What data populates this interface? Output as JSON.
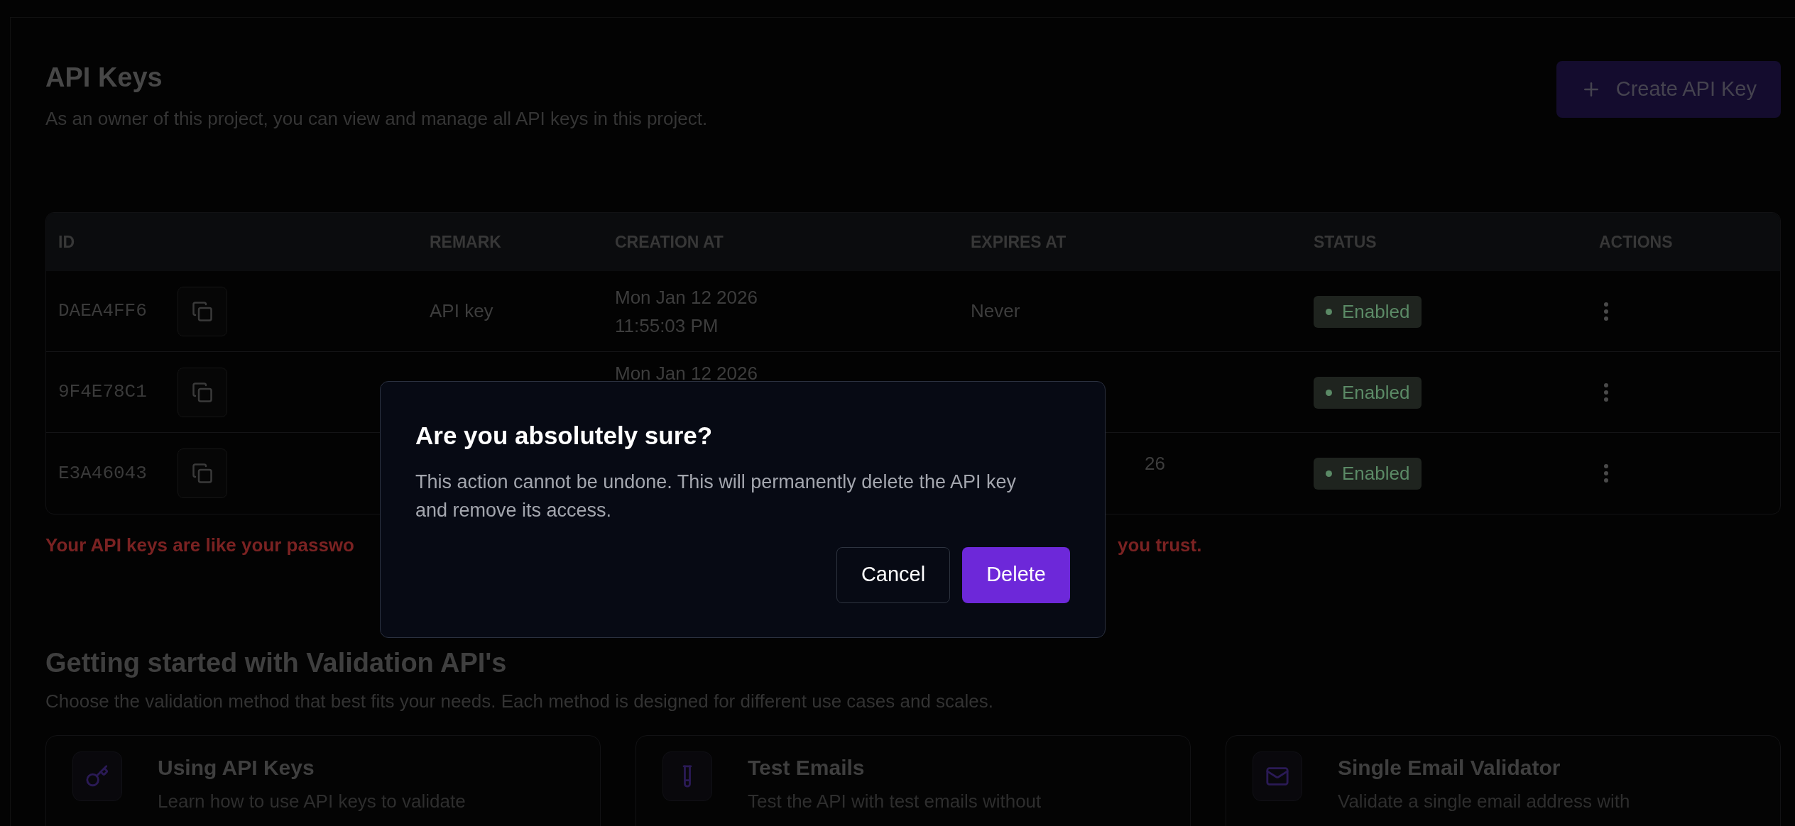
{
  "page": {
    "title": "API Keys",
    "subtitle": "As an owner of this project, you can view and manage all API keys in this project."
  },
  "create_button": {
    "label": "Create API Key"
  },
  "table": {
    "columns": [
      "ID",
      "REMARK",
      "CREATION AT",
      "EXPIRES AT",
      "STATUS",
      "ACTIONS"
    ],
    "rows": [
      {
        "id": "DAEA4FF6",
        "remark": "API key",
        "creation_at": [
          "Mon Jan 12 2026",
          "11:55:03 PM"
        ],
        "expires_at": "Never",
        "status": "Enabled"
      },
      {
        "id": "9F4E78C1",
        "creation_at": [
          "Mon Jan 12 2026"
        ],
        "status": "Enabled"
      },
      {
        "id": "E3A46043",
        "expires_at": "26",
        "status": "Enabled"
      }
    ]
  },
  "warning": [
    "Your API keys are like your passwo",
    "you trust."
  ],
  "getting_started": {
    "title": "Getting started with Validation API's",
    "subtitle": "Choose the validation method that best fits your needs. Each method is designed for different use cases and scales.",
    "cards": [
      {
        "kind": "key",
        "title": "Using API Keys",
        "description": "Learn how to use API keys to validate"
      },
      {
        "kind": "test",
        "title": "Test Emails",
        "description": "Test the API with test emails without"
      },
      {
        "kind": "mail",
        "title": "Single Email Validator",
        "description": "Validate a single email address with"
      }
    ]
  },
  "dialog": {
    "title": "Are you absolutely sure?",
    "message": "This action cannot be undone. This will permanently delete the API key and remove its access.",
    "buttons": [
      {
        "label": "Cancel",
        "kind": "secondary"
      },
      {
        "label": "Delete",
        "kind": "destructive"
      }
    ]
  }
}
